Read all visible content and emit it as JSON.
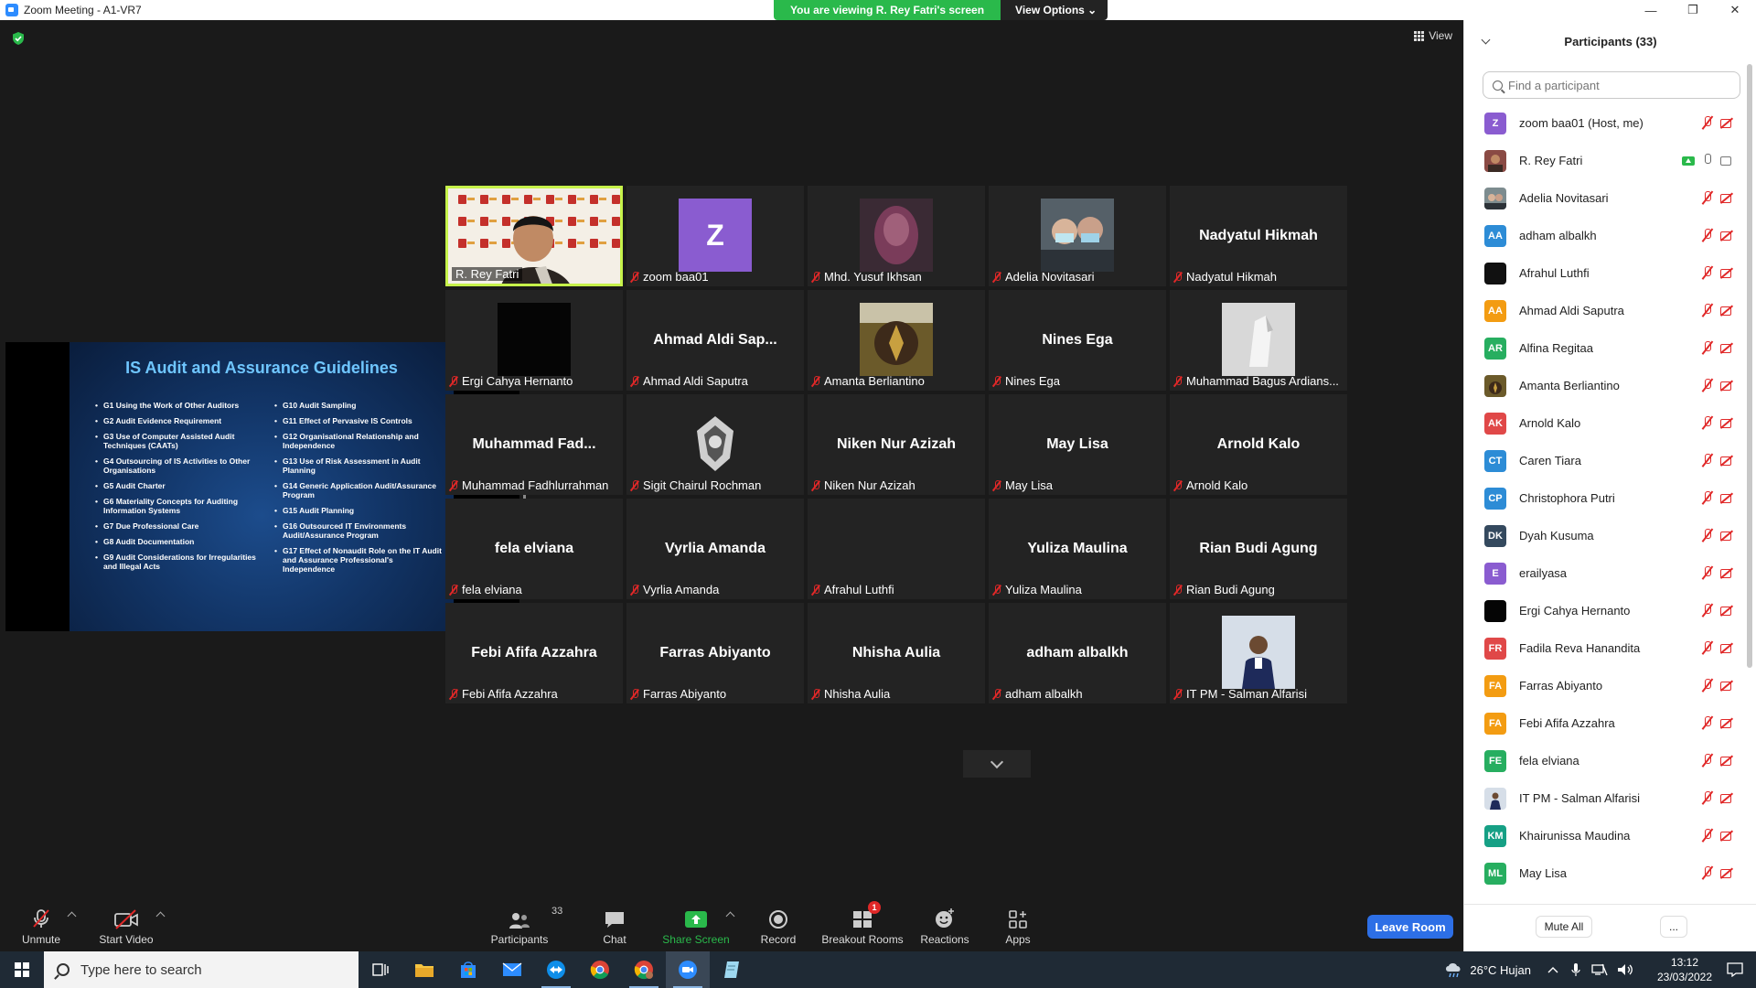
{
  "window": {
    "title": "Zoom Meeting - A1-VR7",
    "minimize": "—",
    "restore": "❐",
    "close": "✕"
  },
  "share_banner": {
    "viewing_text": "You are viewing R. Rey Fatri's screen",
    "view_options_label": "View Options ⌄"
  },
  "view_button_label": "View",
  "slide": {
    "title": "IS Audit and Assurance Guidelines",
    "left_items": [
      "G1 Using the Work of Other Auditors",
      "G2 Audit Evidence Requirement",
      "G3 Use of Computer Assisted Audit Techniques (CAATs)",
      "G4 Outsourcing of IS Activities to Other Organisations",
      "G5 Audit Charter",
      "G6 Materiality Concepts for Auditing Information Systems",
      "G7 Due Professional Care",
      "G8 Audit Documentation",
      "G9 Audit Considerations for Irregularities and Illegal Acts"
    ],
    "right_items": [
      "G10 Audit Sampling",
      "G11 Effect of Pervasive IS Controls",
      "G12 Organisational Relationship and Independence",
      "G13 Use of Risk Assessment in Audit Planning",
      "G14 Generic Application Audit/Assurance Program",
      "G15 Audit Planning",
      "G16 Outsourced IT Environments Audit/Assurance Program",
      "G17 Effect of Nonaudit Role on the IT Audit and Assurance Professional's Independence"
    ]
  },
  "tiles": [
    {
      "label": "R. Rey Fatri",
      "center": "",
      "kind": "video",
      "muted": false,
      "active": true
    },
    {
      "label": "zoom baa01",
      "center": "Z",
      "kind": "avatar",
      "muted": true
    },
    {
      "label": "Mhd. Yusuf Ikhsan",
      "center": "",
      "kind": "photo",
      "muted": true
    },
    {
      "label": "Adelia Novitasari",
      "center": "",
      "kind": "photo",
      "muted": true
    },
    {
      "label": "Nadyatul Hikmah",
      "center": "Nadyatul Hikmah",
      "kind": "name",
      "muted": true
    },
    {
      "label": "Ergi Cahya Hernanto",
      "center": "",
      "kind": "photo",
      "muted": true
    },
    {
      "label": "Ahmad Aldi Saputra",
      "center": "Ahmad  Aldi Sap...",
      "kind": "name",
      "muted": true
    },
    {
      "label": "Amanta Berliantino",
      "center": "",
      "kind": "photo",
      "muted": true
    },
    {
      "label": "Nines Ega",
      "center": "Nines Ega",
      "kind": "name",
      "muted": true
    },
    {
      "label": "Muhammad Bagus Ardians...",
      "center": "",
      "kind": "photo",
      "muted": true
    },
    {
      "label": "Muhammad Fadhlurrahman",
      "center": "Muhammad  Fad...",
      "kind": "name",
      "muted": true
    },
    {
      "label": "Sigit Chairul Rochman",
      "center": "",
      "kind": "photo",
      "muted": true
    },
    {
      "label": "Niken Nur Azizah",
      "center": "Niken Nur Azizah",
      "kind": "name",
      "muted": true
    },
    {
      "label": "May Lisa",
      "center": "May Lisa",
      "kind": "name",
      "muted": true
    },
    {
      "label": "Arnold Kalo",
      "center": "Arnold Kalo",
      "kind": "name",
      "muted": true
    },
    {
      "label": "fela elviana",
      "center": "fela elviana",
      "kind": "name",
      "muted": true
    },
    {
      "label": "Vyrlia Amanda",
      "center": "Vyrlia Amanda",
      "kind": "name",
      "muted": true
    },
    {
      "label": "Afrahul Luthfi",
      "center": "",
      "kind": "blank",
      "muted": true
    },
    {
      "label": "Yuliza Maulina",
      "center": "Yuliza Maulina",
      "kind": "name",
      "muted": true
    },
    {
      "label": "Rian Budi Agung",
      "center": "Rian Budi Agung",
      "kind": "name",
      "muted": true
    },
    {
      "label": "Febi Afifa Azzahra",
      "center": "Febi Afifa Azzahra",
      "kind": "name",
      "muted": true
    },
    {
      "label": "Farras Abiyanto",
      "center": "Farras Abiyanto",
      "kind": "name",
      "muted": true
    },
    {
      "label": "Nhisha Aulia",
      "center": "Nhisha Aulia",
      "kind": "name",
      "muted": true
    },
    {
      "label": "adham albalkh",
      "center": "adham albalkh",
      "kind": "name",
      "muted": true
    },
    {
      "label": "IT PM - Salman Alfarisi",
      "center": "",
      "kind": "photo",
      "muted": true
    }
  ],
  "panel": {
    "title": "Participants (33)",
    "search_placeholder": "Find a participant",
    "participants": [
      {
        "name": "zoom baa01 (Host, me)",
        "initials": "Z",
        "color": "#8a5cd0",
        "mic": "off",
        "cam": "off"
      },
      {
        "name": "R. Rey Fatri",
        "initials": "",
        "color": "#8a4a44",
        "mic": "on",
        "cam": "on",
        "sharing": true
      },
      {
        "name": "Adelia Novitasari",
        "initials": "",
        "color": "#7d8c8f",
        "mic": "off",
        "cam": "off"
      },
      {
        "name": "adham albalkh",
        "initials": "AA",
        "color": "#2d8cd6",
        "mic": "off",
        "cam": "off"
      },
      {
        "name": "Afrahul Luthfi",
        "initials": "",
        "color": "#111111",
        "mic": "off",
        "cam": "off"
      },
      {
        "name": "Ahmad Aldi Saputra",
        "initials": "AA",
        "color": "#f39c12",
        "mic": "off",
        "cam": "off"
      },
      {
        "name": "Alfina Regitaa",
        "initials": "AR",
        "color": "#27ae60",
        "mic": "off",
        "cam": "off"
      },
      {
        "name": "Amanta Berliantino",
        "initials": "",
        "color": "#6b5a2a",
        "mic": "off",
        "cam": "off"
      },
      {
        "name": "Arnold Kalo",
        "initials": "AK",
        "color": "#e04848",
        "mic": "off",
        "cam": "off"
      },
      {
        "name": "Caren Tiara",
        "initials": "CT",
        "color": "#2d8cd6",
        "mic": "off",
        "cam": "off"
      },
      {
        "name": "Christophora Putri",
        "initials": "CP",
        "color": "#2d8cd6",
        "mic": "off",
        "cam": "off"
      },
      {
        "name": "Dyah Kusuma",
        "initials": "DK",
        "color": "#34495e",
        "mic": "off",
        "cam": "off"
      },
      {
        "name": "erailyasa",
        "initials": "E",
        "color": "#8a5cd0",
        "mic": "off",
        "cam": "off"
      },
      {
        "name": "Ergi Cahya Hernanto",
        "initials": "",
        "color": "#111111",
        "mic": "off",
        "cam": "off"
      },
      {
        "name": "Fadila Reva Hanandita",
        "initials": "FR",
        "color": "#e04848",
        "mic": "off",
        "cam": "off"
      },
      {
        "name": "Farras Abiyanto",
        "initials": "FA",
        "color": "#f39c12",
        "mic": "off",
        "cam": "off"
      },
      {
        "name": "Febi Afifa Azzahra",
        "initials": "FA",
        "color": "#f39c12",
        "mic": "off",
        "cam": "off"
      },
      {
        "name": "fela elviana",
        "initials": "FE",
        "color": "#27ae60",
        "mic": "off",
        "cam": "off"
      },
      {
        "name": "IT PM - Salman Alfarisi",
        "initials": "",
        "color": "#9aa6b4",
        "mic": "off",
        "cam": "off"
      },
      {
        "name": "Khairunissa Maudina",
        "initials": "KM",
        "color": "#16a085",
        "mic": "off",
        "cam": "off"
      },
      {
        "name": "May Lisa",
        "initials": "ML",
        "color": "#27ae60",
        "mic": "off",
        "cam": "off"
      }
    ],
    "mute_all_label": "Mute All",
    "more_label": "..."
  },
  "toolbar": {
    "unmute_label": "Unmute",
    "start_video_label": "Start Video",
    "participants_label": "Participants",
    "participants_count": "33",
    "chat_label": "Chat",
    "share_screen_label": "Share Screen",
    "record_label": "Record",
    "breakout_rooms_label": "Breakout Rooms",
    "breakout_badge": "1",
    "reactions_label": "Reactions",
    "apps_label": "Apps",
    "leave_label": "Leave Room"
  },
  "taskbar": {
    "search_placeholder": "Type here to search",
    "weather": "26°C  Hujan",
    "time": "13:12",
    "date": "23/03/2022"
  },
  "colors": {
    "share_green": "#2ab94b",
    "active_speaker": "#c6f24a",
    "leave_blue": "#2d6fe6",
    "muted_red": "#e02828"
  }
}
